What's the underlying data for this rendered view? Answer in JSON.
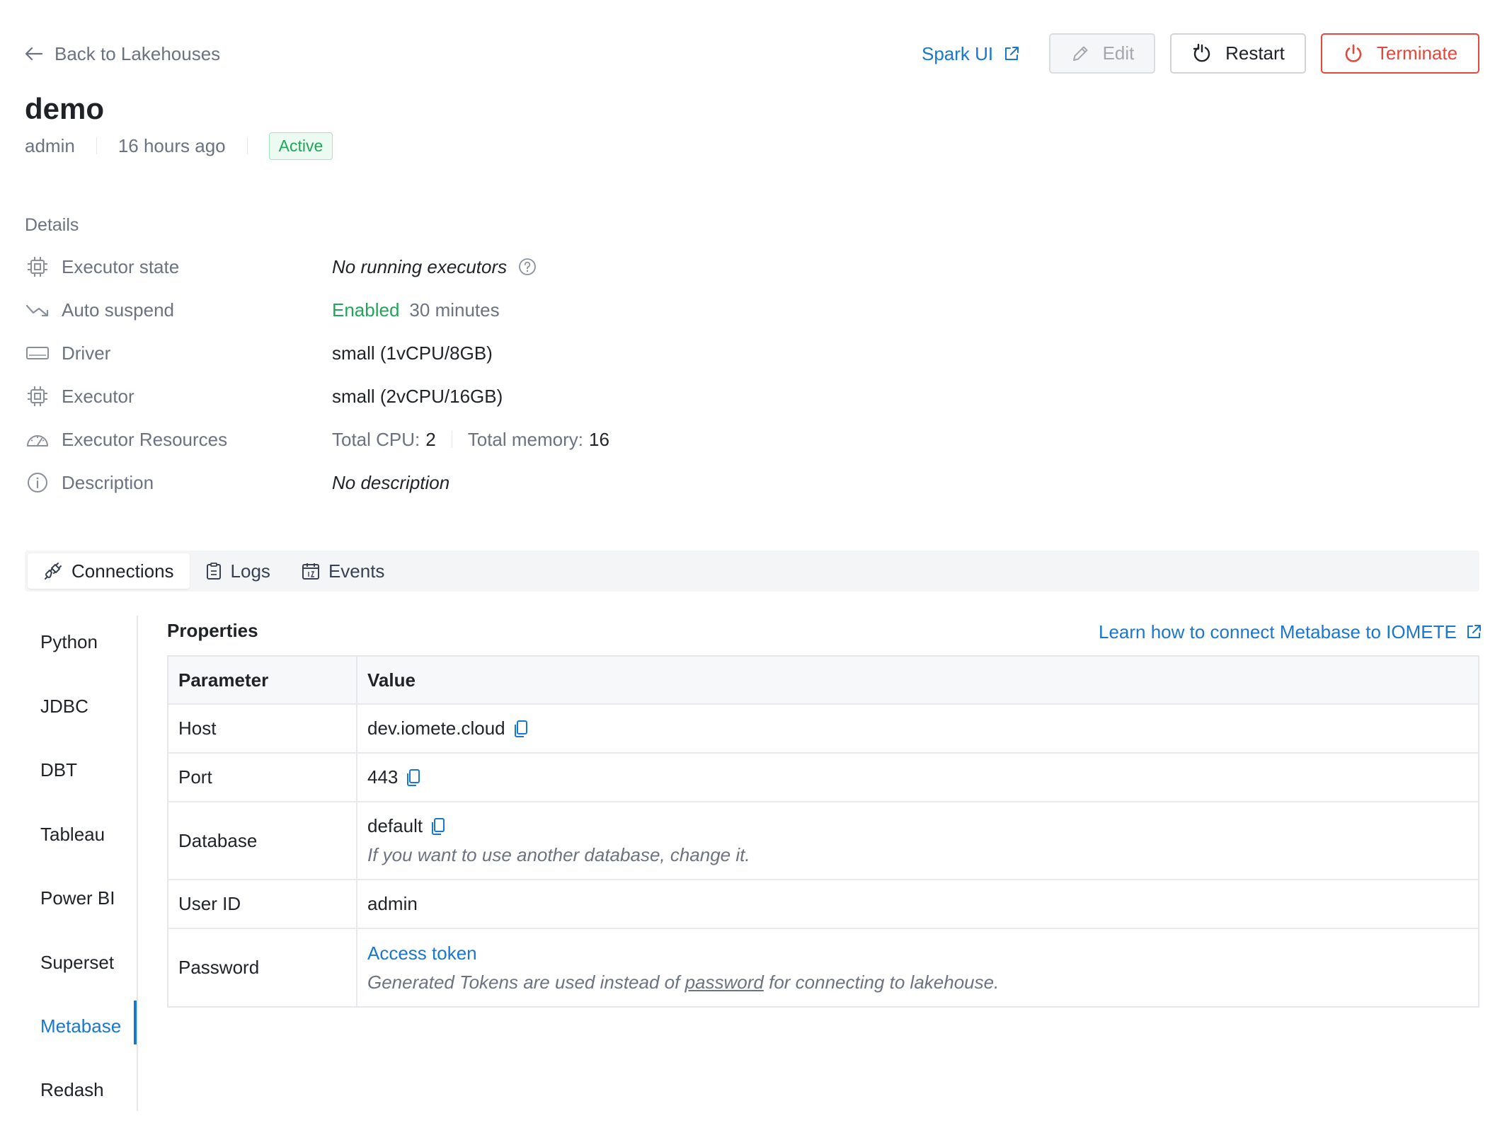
{
  "header": {
    "back_label": "Back to Lakehouses",
    "title": "demo",
    "owner": "admin",
    "created": "16 hours ago",
    "status": "Active",
    "spark_ui_label": "Spark UI",
    "edit_label": "Edit",
    "restart_label": "Restart",
    "terminate_label": "Terminate"
  },
  "details": {
    "section_label": "Details",
    "executor_state": {
      "label": "Executor state",
      "value": "No running executors"
    },
    "auto_suspend": {
      "label": "Auto suspend",
      "status": "Enabled",
      "duration": "30 minutes"
    },
    "driver": {
      "label": "Driver",
      "value": "small (1vCPU/8GB)"
    },
    "executor": {
      "label": "Executor",
      "value": "small (2vCPU/16GB)"
    },
    "executor_resources": {
      "label": "Executor Resources",
      "cpu_label": "Total CPU:",
      "cpu_value": "2",
      "memory_label": "Total memory:",
      "memory_value": "16"
    },
    "description": {
      "label": "Description",
      "value": "No description"
    }
  },
  "tabs": [
    {
      "label": "Connections",
      "active": true
    },
    {
      "label": "Logs",
      "active": false
    },
    {
      "label": "Events",
      "active": false
    }
  ],
  "connections_nav": {
    "items": [
      "Python",
      "JDBC",
      "DBT",
      "Tableau",
      "Power BI",
      "Superset",
      "Metabase",
      "Redash"
    ],
    "active": "Metabase"
  },
  "properties": {
    "title": "Properties",
    "learn_link": "Learn how to connect Metabase to IOMETE",
    "columns": [
      "Parameter",
      "Value"
    ],
    "host": {
      "param": "Host",
      "value": "dev.iomete.cloud"
    },
    "port": {
      "param": "Port",
      "value": "443"
    },
    "database": {
      "param": "Database",
      "value": "default",
      "hint": "If you want to use another database, change it."
    },
    "user_id": {
      "param": "User ID",
      "value": "admin"
    },
    "password": {
      "param": "Password",
      "link": "Access token",
      "hint_before": "Generated Tokens are used instead of",
      "hint_link": "password",
      "hint_after": "for connecting to lakehouse."
    }
  },
  "colors": {
    "accent": "#1976d2",
    "success": "#21a55b",
    "danger": "#e2483b",
    "muted": "#6b7280"
  }
}
